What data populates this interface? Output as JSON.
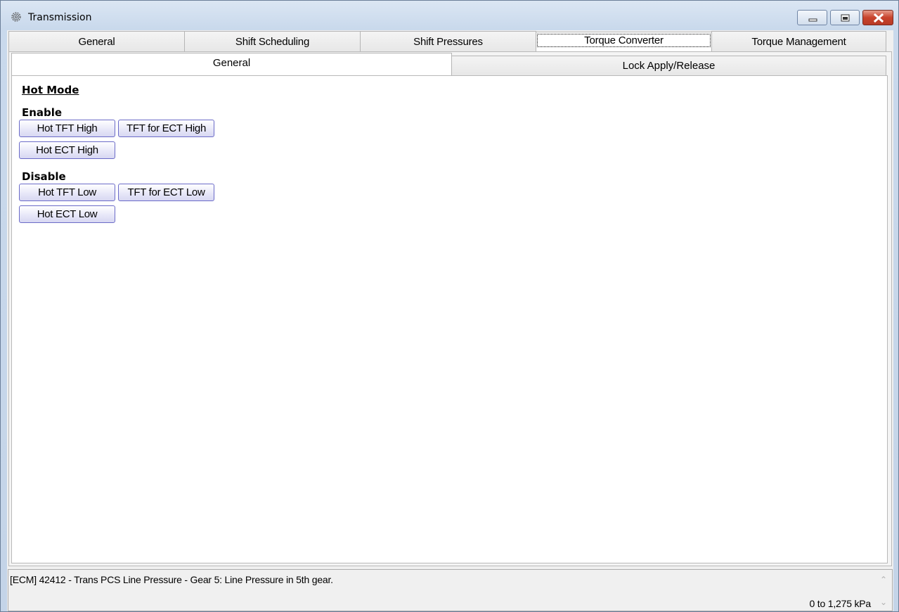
{
  "window": {
    "title": "Transmission",
    "icon": "gear-icon",
    "controls": {
      "minimize": "minimize-icon",
      "maximize": "maximize-icon",
      "close": "close-icon"
    }
  },
  "tabs": [
    {
      "label": "General"
    },
    {
      "label": "Shift Scheduling"
    },
    {
      "label": "Shift Pressures"
    },
    {
      "label": "Torque Converter"
    },
    {
      "label": "Torque Management"
    }
  ],
  "active_tab": "Torque Converter",
  "subtabs": [
    {
      "label": "General"
    },
    {
      "label": "Lock Apply/Release"
    }
  ],
  "active_subtab": "General",
  "content": {
    "section_title": "Hot Mode",
    "enable": {
      "label": "Enable",
      "buttons": [
        "Hot TFT High",
        "TFT for ECT High",
        "Hot ECT High"
      ]
    },
    "disable": {
      "label": "Disable",
      "buttons": [
        "Hot TFT Low",
        "TFT for ECT Low",
        "Hot ECT Low"
      ]
    }
  },
  "status": {
    "message": "[ECM] 42412 - Trans PCS Line Pressure - Gear 5: Line Pressure in 5th gear.",
    "range": "0 to 1,275 kPa"
  }
}
